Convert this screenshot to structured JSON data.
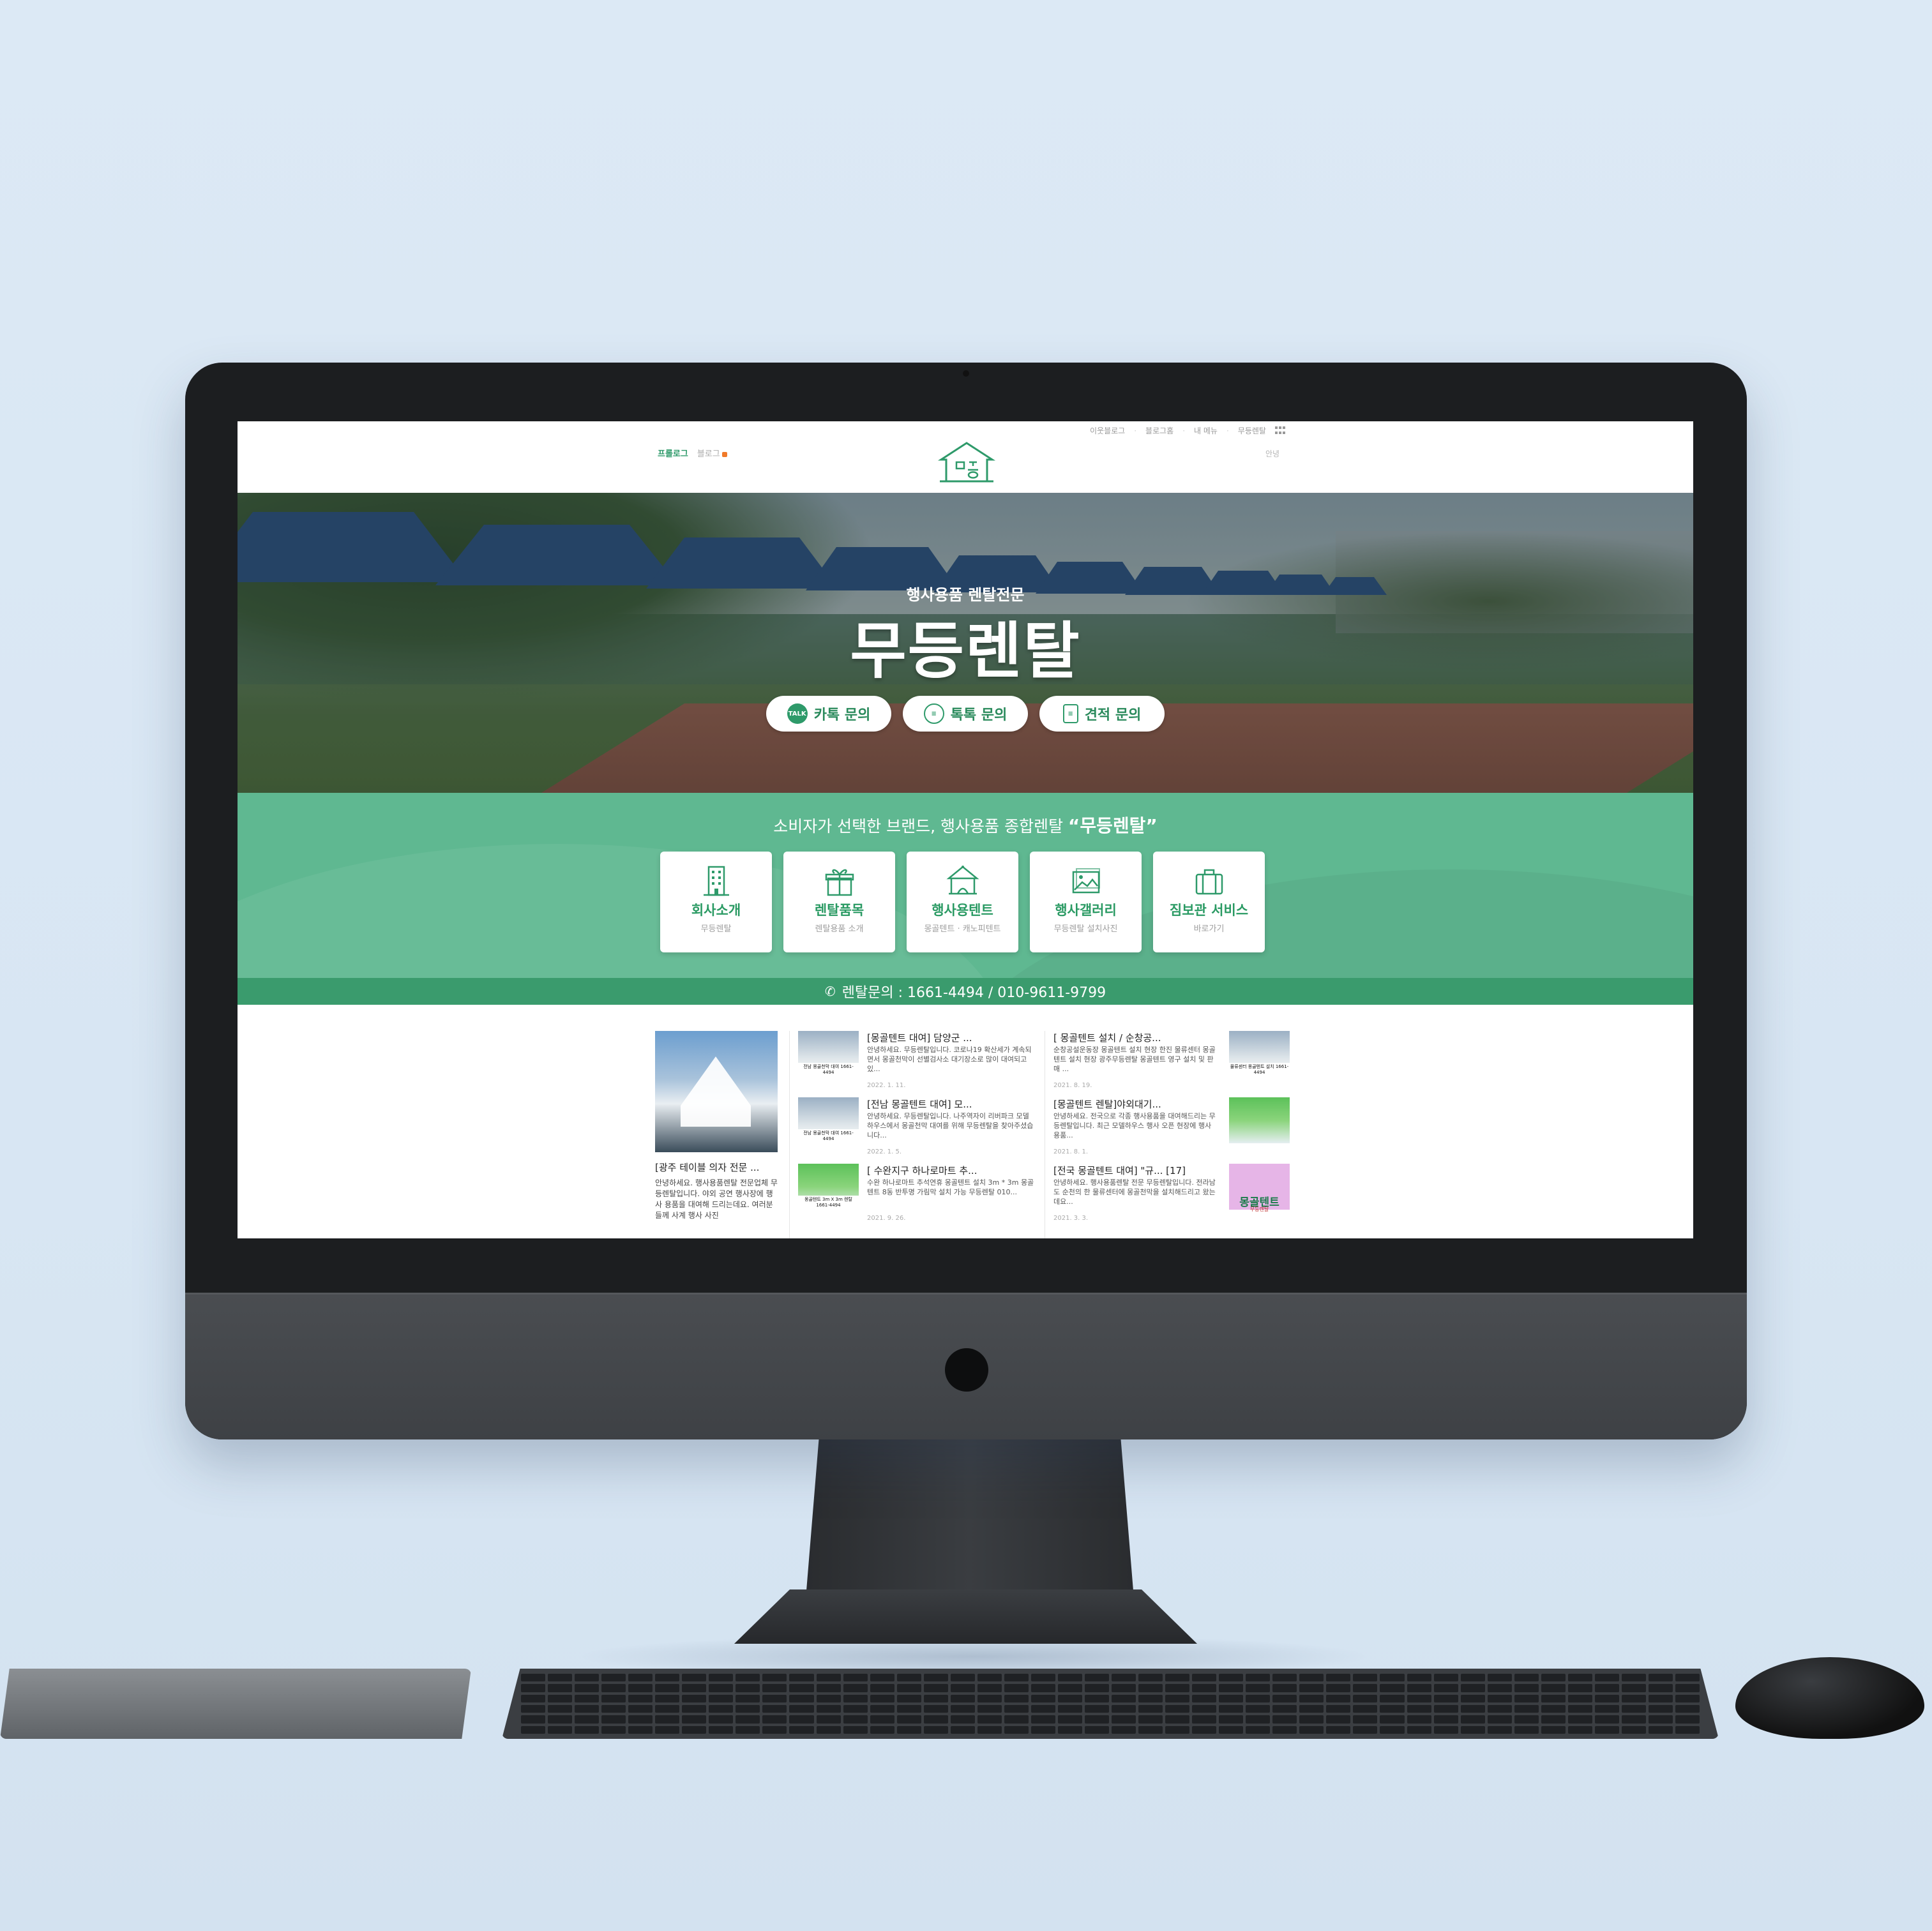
{
  "site": {
    "util_links": [
      "이웃블로그",
      "블로그홈",
      "내 메뉴",
      "무등렌탈"
    ],
    "blog_tabs": {
      "prologue": "프롤로그",
      "blog": "블로그"
    },
    "login": "안녕",
    "hero": {
      "subtitle": "행사용품 렌탈전문",
      "title": "무등렌탈",
      "buttons": [
        {
          "icon": "kakaotalk-icon",
          "icon_text": "TALK",
          "label": "카톡 문의"
        },
        {
          "icon": "talktalk-icon",
          "label": "톡톡 문의"
        },
        {
          "icon": "clipboard-icon",
          "label": "견적 문의"
        }
      ]
    },
    "band": {
      "tagline": "소비자가 선택한 브랜드, 행사용품 종합렌탈",
      "tagline_brand": "“무등렌탈”",
      "cards": [
        {
          "icon": "building-icon",
          "title": "회사소개",
          "desc": "무등렌탈"
        },
        {
          "icon": "gift-icon",
          "title": "렌탈품목",
          "desc": "렌탈용품 소개"
        },
        {
          "icon": "tent-icon",
          "title": "행사용텐트",
          "desc": "몽골텐트 · 캐노피텐트"
        },
        {
          "icon": "gallery-icon",
          "title": "행사갤러리",
          "desc": "무등렌탈 설치사진"
        },
        {
          "icon": "suitcase-icon",
          "title": "짐보관 서비스",
          "desc": "바로가기"
        }
      ]
    },
    "contact_bar": "렌탈문의 : 1661-4494  /  010-9611-9799",
    "posts": {
      "feature": {
        "title": "[광주 테이블 의자 전문 ...",
        "excerpt": "안녕하세요. 행사용품렌탈 전문업체 무등렌탈입니다. 야외 공연 행사장에 행사 용품을 대여해 드리는데요. 여러분들께 사계 행사 사진"
      },
      "left": [
        {
          "title": "[몽골텐트 대여] 담양군 ...",
          "excerpt": "안녕하세요. 무등렌탈입니다. 코로나19 확산세가 계속되면서 몽골천막이 선별검사소 대기장소로 많이 대여되고 있...",
          "date": "2022. 1. 11.",
          "thumb_caption": "전남 몽골천막 대여 1661-4494"
        },
        {
          "title": "[전남 몽골텐트 대여] 모...",
          "excerpt": "안녕하세요. 무등렌탈입니다. 나주역자이 리버파크 모델하우스에서 몽골천막 대여를 위해 무등렌탈을 찾아주셨습니다...",
          "date": "2022. 1. 5.",
          "thumb_caption": "전남 몽골천막 대여 1661-4494"
        },
        {
          "title": "[ 수완지구 하나로마트 추...",
          "excerpt": "수완 하나로마트 추석연휴 몽골텐트 설치 3m * 3m 몽골텐트 8동 반투명 가림막 설치 가능 무등렌탈 010...",
          "date": "2021. 9. 26.",
          "thumb_caption": "몽골텐트 3m X 3m 렌탈 1661-4494"
        }
      ],
      "right": [
        {
          "title": "[ 몽골텐트 설치 / 순창공...",
          "excerpt": "순창공설운동장 몽골텐트 설치 현장 한진 물류센터 몽골텐트 설치 현장 광주무등렌탈 몽골텐트 영구 설치 및 판매 ...",
          "date": "2021. 8. 19.",
          "thumb_caption": "물류센터 몽골텐트 설치 1661-4494"
        },
        {
          "title": "[몽골텐트 렌탈]야외대기...",
          "excerpt": "안녕하세요. 전국으로 각종 행사용품을 대여해드리는 무등렌탈입니다. 최근 모델하우스 행사 오픈 현장에 행사용품...",
          "date": "2021. 8. 1.",
          "thumb_caption": ""
        },
        {
          "title": "[전국 몽골텐트 대여] \"규... [17]",
          "excerpt": "안녕하세요. 행사용품렌탈 전문 무등렌탈입니다. 전라남도 순천의 한 물류센터에 몽골천막을 설치해드리고 왔는데요...",
          "date": "2021. 3. 3.",
          "thumb_caption": "",
          "thumb_title": "몽골텐트",
          "thumb_sub": "무등렌탈"
        }
      ]
    }
  }
}
